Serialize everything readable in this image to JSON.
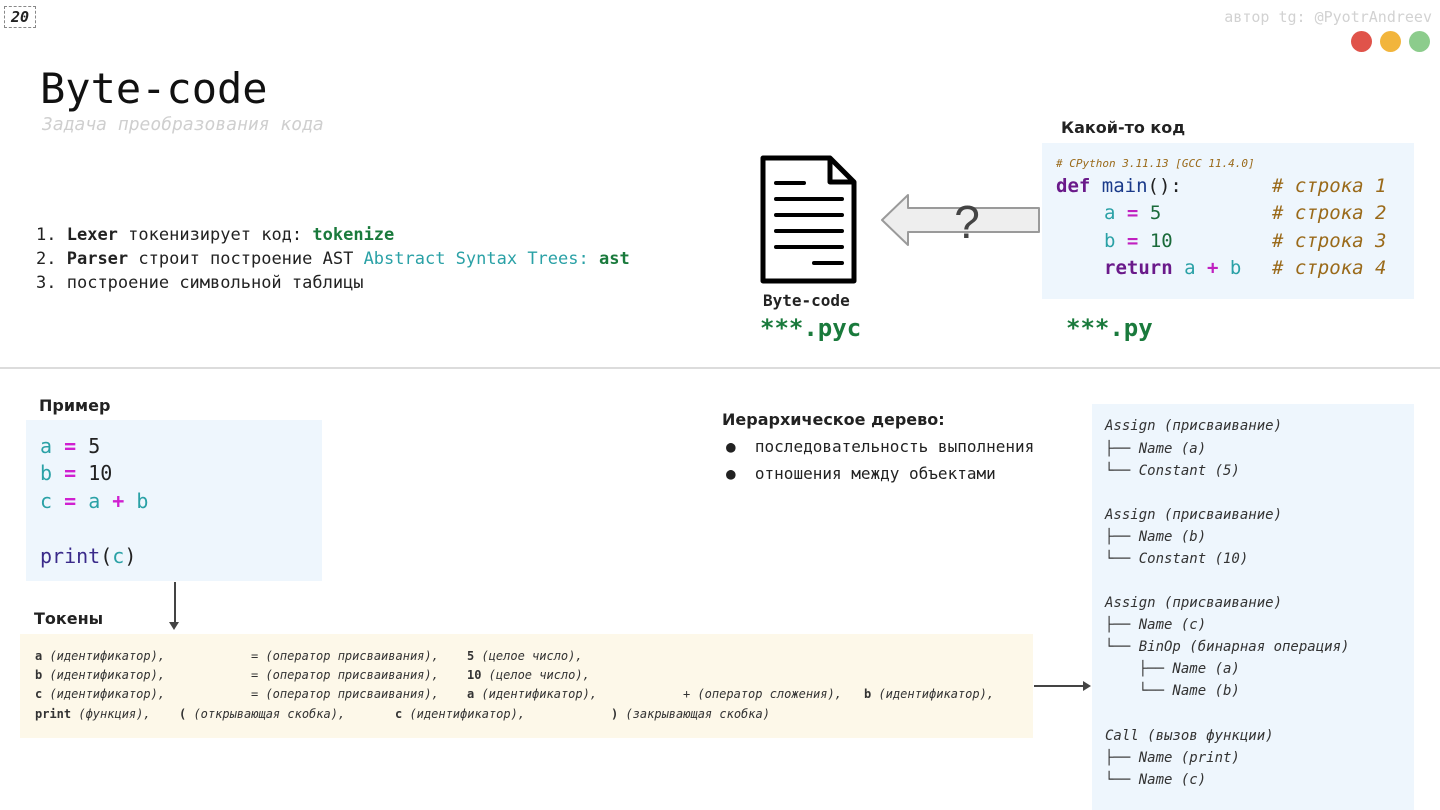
{
  "page_number": "20",
  "author": "автор tg: @PyotrAndreev",
  "window_dots": [
    "#e0534a",
    "#f2b53c",
    "#8ccc8c"
  ],
  "title": "Byte-code",
  "subtitle": "Задача преобразования кода",
  "steps": [
    {
      "num": "1.",
      "bold": "Lexer",
      "text": " токенизирует код: ",
      "module": "tokenize"
    },
    {
      "num": "2.",
      "bold": "Parser",
      "text": " строит построение AST ",
      "link": "Abstract Syntax Trees",
      "sep": ": ",
      "module": "ast"
    },
    {
      "num": "3.",
      "text": "построение символьной таблицы"
    }
  ],
  "bytecode_label": "Byte-code",
  "pyc_ext": "***.pyc",
  "question_mark": "?",
  "py_ext": "***.py",
  "code_header": "Какой-то код",
  "code_version": "# CPython 3.11.13 [GCC 11.4.0]",
  "code": {
    "l1_kw": "def",
    "l1_fn": "main",
    "l1_rest": "():",
    "l1_cmt": "# строка 1",
    "l2_var": "a",
    "l2_op": "=",
    "l2_num": "5",
    "l2_cmt": "# строка 2",
    "l3_var": "b",
    "l3_op": "=",
    "l3_num": "10",
    "l3_cmt": "# строка 3",
    "l4_kw": "return",
    "l4_a": "a",
    "l4_op": "+",
    "l4_b": "b",
    "l4_cmt": "# строка 4"
  },
  "example_header": "Пример",
  "example": {
    "l1_var": "a",
    "l1_op": "=",
    "l1_val": "5",
    "l2_var": "b",
    "l2_op": "=",
    "l2_val": "10",
    "l3_var": "c",
    "l3_op": "=",
    "l3_a": "a",
    "l3_plus": "+",
    "l3_b": "b",
    "l5_fn": "print",
    "l5_open": "(",
    "l5_arg": "c",
    "l5_close": ")"
  },
  "tokens_header": "Токены",
  "tokens": {
    "r1": [
      "a",
      " (идентификатор),",
      "= (оператор присваивания),",
      "5",
      " (целое число),"
    ],
    "r2": [
      "b",
      " (идентификатор),",
      "= (оператор присваивания),",
      "10",
      " (целое число),"
    ],
    "r3": [
      "c",
      " (идентификатор),",
      "= (оператор присваивания),",
      "a",
      " (идентификатор),",
      "+ (оператор сложения),",
      "b",
      " (идентификатор),"
    ],
    "r4": [
      "print",
      " (функция),",
      "(",
      " (открывающая скобка),",
      "c",
      " (идентификатор),",
      ")",
      " (закрывающая скобка)"
    ]
  },
  "hier_header": "Иерархическое дерево:",
  "hier_items": [
    "последовательность выполнения",
    "отношения между объектами"
  ],
  "tree": [
    "Assign (присваивание)",
    "├── Name (a)",
    "└── Constant (5)",
    "Assign (присваивание)",
    "├── Name (b)",
    "└── Constant (10)",
    "Assign (присваивание)",
    "├── Name (c)",
    "└── BinOp (бинарная операция)",
    "    ├── Name (a)",
    "    └── Name (b)",
    "Call (вызов функции)",
    "├── Name (print)",
    "└── Name (c)"
  ]
}
